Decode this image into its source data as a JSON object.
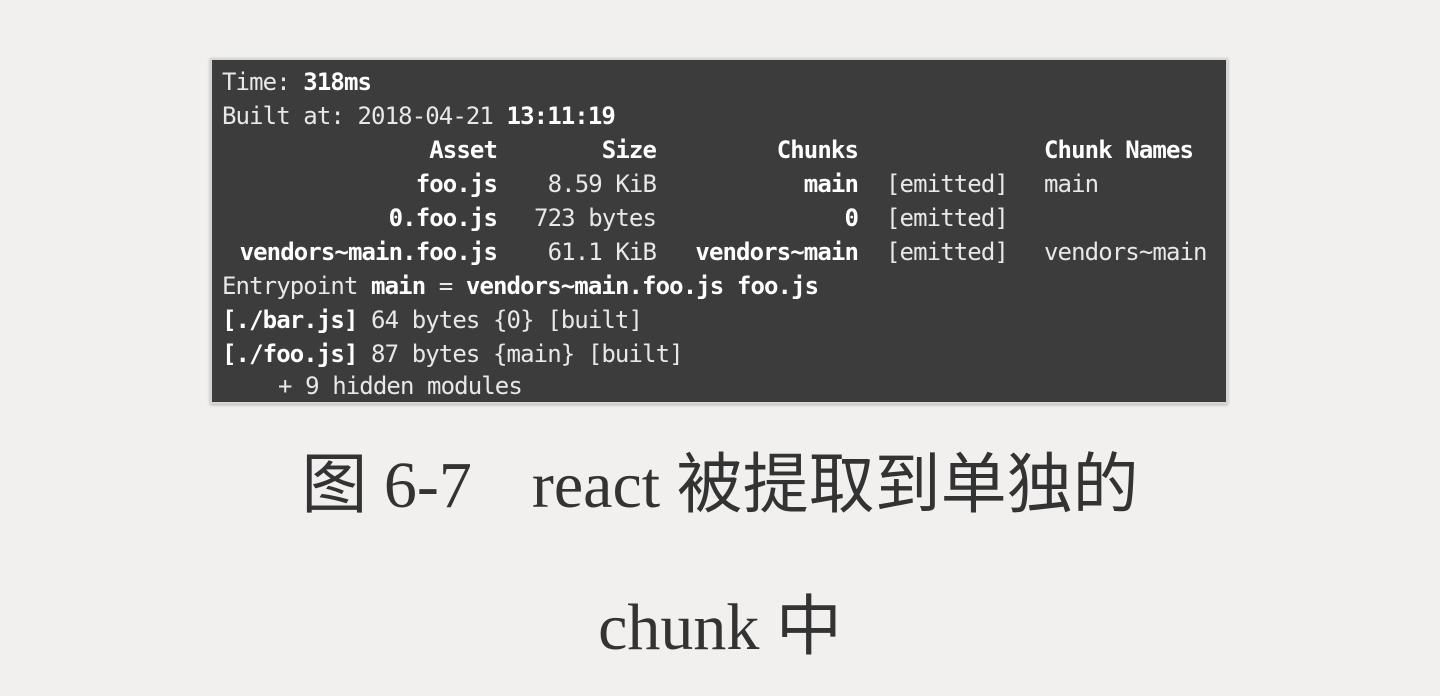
{
  "terminal": {
    "time_label": "Time: ",
    "time_value": "318ms",
    "built_label": "Built at: 2018-04-21 ",
    "built_time": "13:11:19",
    "headers": {
      "asset": "Asset",
      "size": "Size",
      "chunks": "Chunks",
      "chunk_names": "Chunk Names"
    },
    "rows": [
      {
        "asset": "foo.js",
        "size": "8.59 KiB",
        "chunks": "main",
        "status": "[emitted]",
        "names": "main"
      },
      {
        "asset": "0.foo.js",
        "size": "723 bytes",
        "chunks": "0",
        "status": "[emitted]",
        "names": ""
      },
      {
        "asset": "vendors~main.foo.js",
        "size": "61.1 KiB",
        "chunks": "vendors~main",
        "status": "[emitted]",
        "names": "vendors~main"
      }
    ],
    "entrypoint_label": "Entrypoint ",
    "entrypoint_name": "main",
    "entrypoint_eq": " = ",
    "entrypoint_files": "vendors~main.foo.js foo.js",
    "module_lines": [
      {
        "path": "[./bar.js]",
        "rest": " 64 bytes {0} [built]"
      },
      {
        "path": "[./foo.js]",
        "rest": " 87 bytes {main} [built]"
      }
    ],
    "hidden_modules": "+ 9 hidden modules"
  },
  "caption": {
    "figure_label": "图 6-7",
    "title_line1": "react 被提取到单独的",
    "title_line2": "chunk 中"
  }
}
